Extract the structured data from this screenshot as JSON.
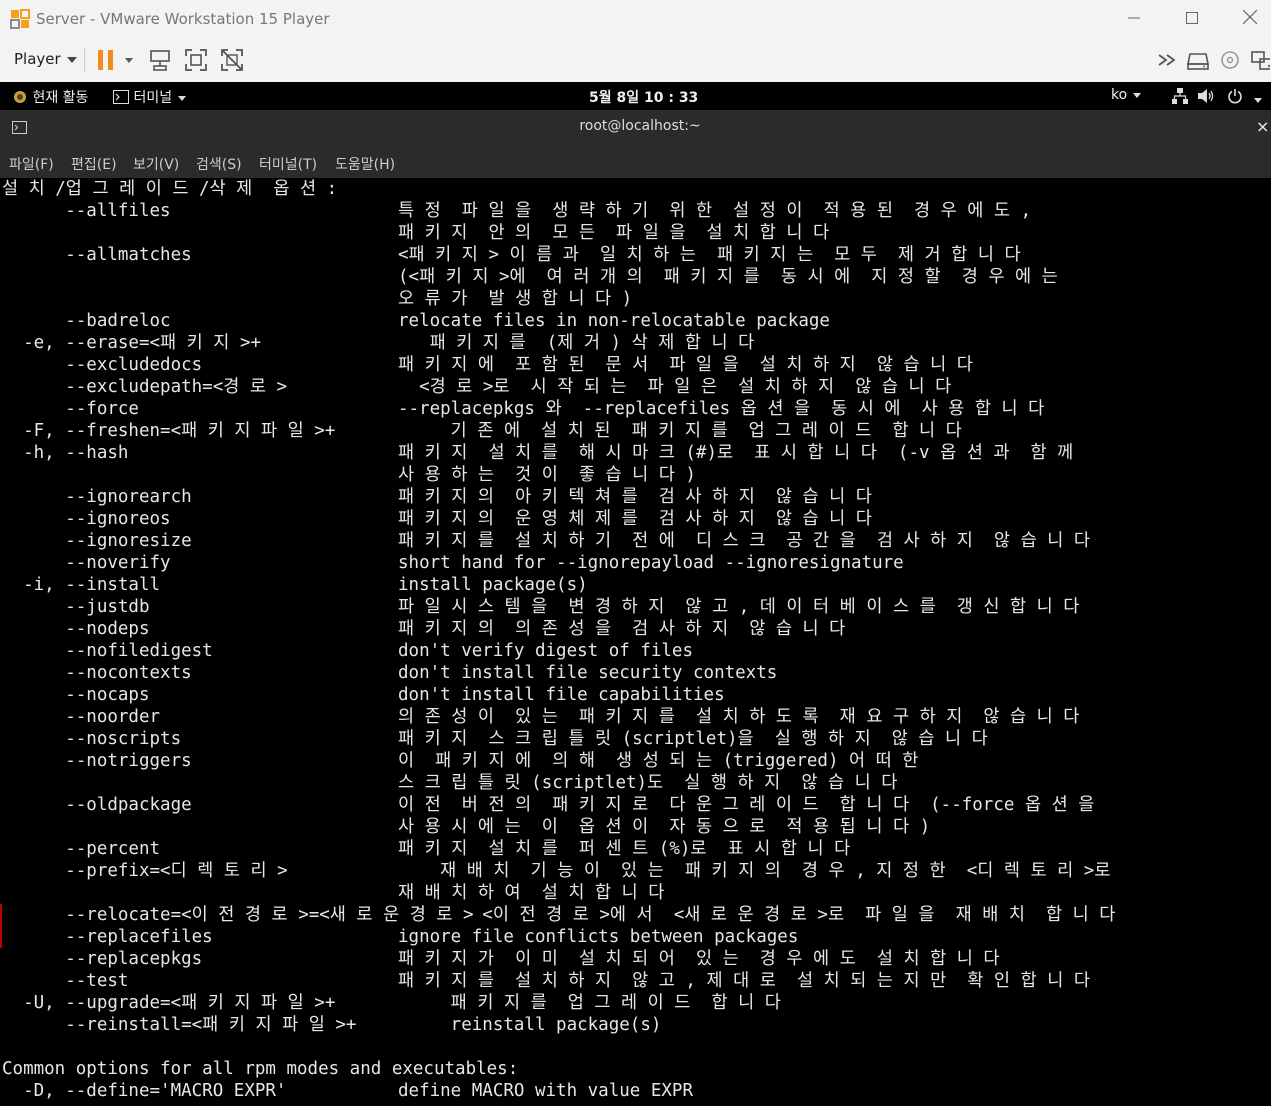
{
  "window": {
    "title": "Server - VMware Workstation 15 Player",
    "minimize_icon": "minimize-icon",
    "maximize_icon": "maximize-icon",
    "close_icon": "close-icon"
  },
  "toolbar": {
    "player_label": "Player",
    "pause_color": "#f08c1c"
  },
  "gnome_bar": {
    "activities": "현재 활동",
    "app_menu": "터미널",
    "clock": "5월 8일 10 : 33",
    "input_method": "ko"
  },
  "terminal": {
    "title": "root@localhost:~",
    "close": "×",
    "menu": [
      "파일(F)",
      "편집(E)",
      "보기(V)",
      "검색(S)",
      "터미널(T)",
      "도움말(H)"
    ],
    "lines": [
      {
        "opt": "설 치 /업 그 레 이 드 /삭 제  옵 션 :",
        "desc": ""
      },
      {
        "opt": "      --allfiles",
        "desc": "특 정  파 일 을  생 략 하 기  위 한  설 정 이  적 용 된  경 우 에 도 ,"
      },
      {
        "opt": "",
        "desc": "패 키 지  안 의  모 든  파 일 을  설 치 합 니 다"
      },
      {
        "opt": "      --allmatches",
        "desc": "<패 키 지 > 이 름 과  일 치 하 는  패 키 지 는  모 두  제 거 합 니 다"
      },
      {
        "opt": "",
        "desc": "(<패 키 지 >에  여 러 개 의  패 키 지 를  동 시 에  지 정 할  경 우 에 는"
      },
      {
        "opt": "",
        "desc": "오 류 가  발 생 합 니 다 )"
      },
      {
        "opt": "      --badreloc",
        "desc": "relocate files in non-relocatable package"
      },
      {
        "opt": "  -e, --erase=<패 키 지 >+",
        "desc": "   패 키 지 를  (제 거 ) 삭 제 합 니 다"
      },
      {
        "opt": "      --excludedocs",
        "desc": "패 키 지 에  포 함 된  문 서  파 일 을  설 치 하 지  않 습 니 다"
      },
      {
        "opt": "      --excludepath=<경 로 >",
        "desc": "  <경 로 >로  시 작 되 는  파 일 은  설 치 하 지  않 습 니 다"
      },
      {
        "opt": "      --force",
        "desc": "--replacepkgs 와  --replacefiles 옵 션 을  동 시 에  사 용 합 니 다"
      },
      {
        "opt": "  -F, --freshen=<패 키 지 파 일 >+",
        "desc": "     기 존 에  설 치 된  패 키 지 를  업 그 레 이 드  합 니 다"
      },
      {
        "opt": "  -h, --hash",
        "desc": "패 키 지  설 치 를  해 시 마 크 (#)로  표 시 합 니 다  (-v 옵 션 과  함 께"
      },
      {
        "opt": "",
        "desc": "사 용 하 는  것 이  좋 습 니 다 )"
      },
      {
        "opt": "      --ignorearch",
        "desc": "패 키 지 의  아 키 텍 쳐 를  검 사 하 지  않 습 니 다"
      },
      {
        "opt": "      --ignoreos",
        "desc": "패 키 지 의  운 영 체 제 를  검 사 하 지  않 습 니 다"
      },
      {
        "opt": "      --ignoresize",
        "desc": "패 키 지 를  설 치 하 기  전 에  디 스 크  공 간 을  검 사 하 지  않 습 니 다"
      },
      {
        "opt": "      --noverify",
        "desc": "short hand for --ignorepayload --ignoresignature"
      },
      {
        "opt": "  -i, --install",
        "desc": "install package(s)"
      },
      {
        "opt": "      --justdb",
        "desc": "파 일 시 스 템 을  변 경 하 지  않 고 , 데 이 터 베 이 스 를  갱 신 합 니 다"
      },
      {
        "opt": "      --nodeps",
        "desc": "패 키 지 의  의 존 성 을  검 사 하 지  않 습 니 다"
      },
      {
        "opt": "      --nofiledigest",
        "desc": "don't verify digest of files"
      },
      {
        "opt": "      --nocontexts",
        "desc": "don't install file security contexts"
      },
      {
        "opt": "      --nocaps",
        "desc": "don't install file capabilities"
      },
      {
        "opt": "      --noorder",
        "desc": "의 존 성 이  있 는  패 키 지 를  설 치 하 도 록  재 요 구 하 지  않 습 니 다"
      },
      {
        "opt": "      --noscripts",
        "desc": "패 키 지  스 크 립 틀 릿 (scriptlet)을  실 행 하 지  않 습 니 다"
      },
      {
        "opt": "      --notriggers",
        "desc": "이  패 키 지 에  의 해  생 성 되 는 (triggered) 어 떠 한"
      },
      {
        "opt": "",
        "desc": "스 크 립 틀 릿 (scriptlet)도  실 행 하 지  않 습 니 다"
      },
      {
        "opt": "      --oldpackage",
        "desc": "이 전  버 전 의  패 키 지 로  다 운 그 레 이 드  합 니 다  (--force 옵 션 을"
      },
      {
        "opt": "",
        "desc": "사 용 시 에 는  이  옵 션 이  자 동 으 로  적 용 됩 니 다 )"
      },
      {
        "opt": "      --percent",
        "desc": "패 키 지  설 치 를  퍼 센 트 (%)로  표 시 합 니 다"
      },
      {
        "opt": "      --prefix=<디 렉 토 리 >",
        "desc": "    재 배 치  기 능 이  있 는  패 키 지 의  경 우 , 지 정 한  <디 렉 토 리 >로"
      },
      {
        "opt": "",
        "desc": "재 배 치 하 여  설 치 합 니 다"
      },
      {
        "opt": "      --relocate=<이 전 경 로 >=<새 로 운 경 로 >",
        "desc": "        <이 전 경 로 >에 서  <새 로 운 경 로 >로  파 일 을  재 배 치  합 니 다"
      },
      {
        "opt": "      --replacefiles",
        "desc": "ignore file conflicts between packages"
      },
      {
        "opt": "      --replacepkgs",
        "desc": "패 키 지 가  이 미  설 치 되 어  있 는  경 우 에 도  설 치 합 니 다"
      },
      {
        "opt": "      --test",
        "desc": "패 키 지 를  설 치 하 지  않 고 , 제 대 로  설 치 되 는 지 만  확 인 합 니 다"
      },
      {
        "opt": "  -U, --upgrade=<패 키 지 파 일 >+",
        "desc": "     패 키 지 를  업 그 레 이 드  합 니 다"
      },
      {
        "opt": "      --reinstall=<패 키 지 파 일 >+",
        "desc": "     reinstall package(s)"
      },
      {
        "opt": "",
        "desc": ""
      },
      {
        "opt": "Common options for all rpm modes and executables:",
        "desc": ""
      },
      {
        "opt": "  -D, --define='MACRO EXPR'",
        "desc": "define MACRO with value EXPR"
      }
    ]
  }
}
